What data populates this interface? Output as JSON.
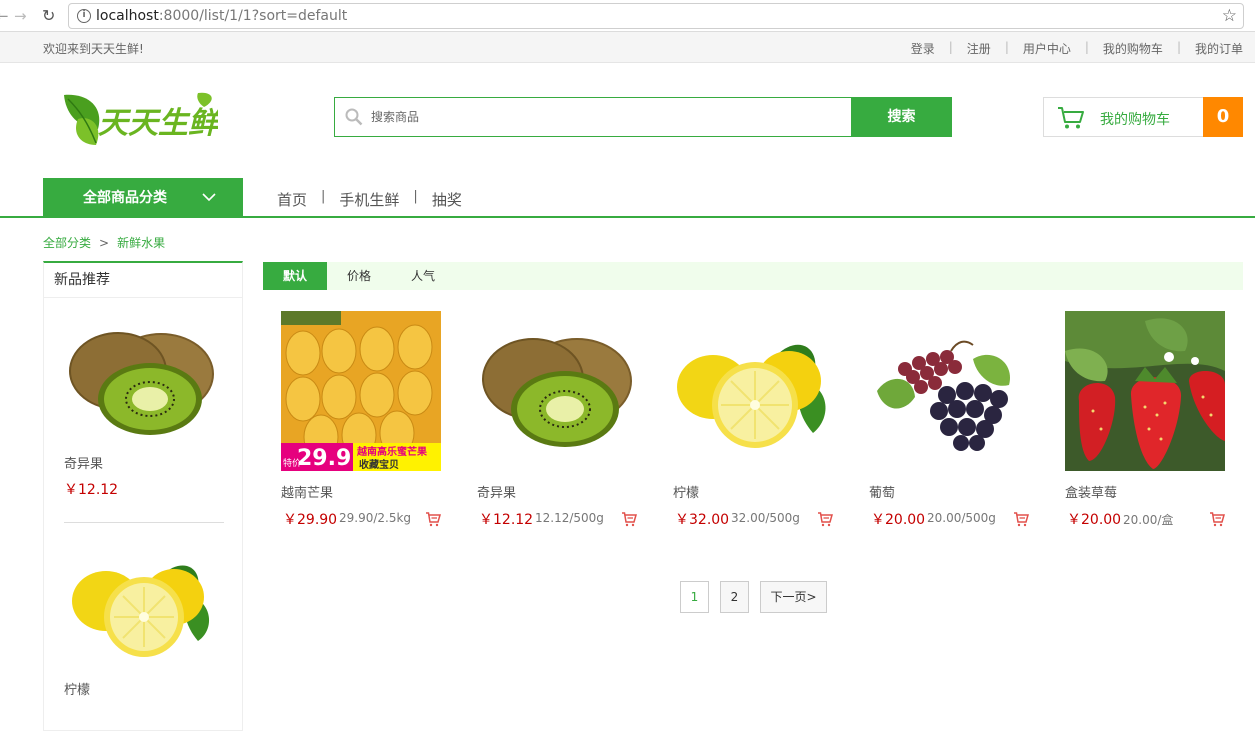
{
  "browser": {
    "url_host": "localhost",
    "url_rest": ":8000/list/1/1?sort=default"
  },
  "topbar": {
    "welcome": "欢迎来到天天生鲜!",
    "links": [
      "登录",
      "注册",
      "用户中心",
      "我的购物车",
      "我的订单"
    ]
  },
  "header": {
    "logo_text": "天天生鲜",
    "search_placeholder": "搜索商品",
    "search_button": "搜索",
    "cart_label": "我的购物车",
    "cart_count": "0"
  },
  "nav": {
    "all_categories": "全部商品分类",
    "menu": [
      "首页",
      "手机生鲜",
      "抽奖"
    ]
  },
  "breadcrumb": {
    "root": "全部分类",
    "separator": ">",
    "current": "新鲜水果"
  },
  "sidebar": {
    "title": "新品推荐",
    "items": [
      {
        "name": "奇异果",
        "price": "￥12.12",
        "icon": "kiwi"
      },
      {
        "name": "柠檬",
        "price": "",
        "icon": "lemon"
      }
    ]
  },
  "sort_tabs": {
    "default": "默认",
    "price": "价格",
    "popularity": "人气"
  },
  "products": [
    {
      "name": "越南芒果",
      "price": "￥29.90",
      "unit": "29.90/2.5kg",
      "icon": "mango-box",
      "promo_price": "29.9",
      "promo_title": "越南高乐蜜芒果",
      "promo_sub": "收藏宝贝",
      "promo_tag": "特价"
    },
    {
      "name": "奇异果",
      "price": "￥12.12",
      "unit": "12.12/500g",
      "icon": "kiwi"
    },
    {
      "name": "柠檬",
      "price": "￥32.00",
      "unit": "32.00/500g",
      "icon": "lemon"
    },
    {
      "name": "葡萄",
      "price": "￥20.00",
      "unit": "20.00/500g",
      "icon": "grapes"
    },
    {
      "name": "盒装草莓",
      "price": "￥20.00",
      "unit": "20.00/盒",
      "icon": "strawberry"
    }
  ],
  "pagination": {
    "pages": [
      "1",
      "2"
    ],
    "next": "下一页>",
    "current": "1"
  },
  "colors": {
    "brand_green": "#37ab40",
    "price_red": "#c40000",
    "cart_orange": "#ff8800"
  }
}
